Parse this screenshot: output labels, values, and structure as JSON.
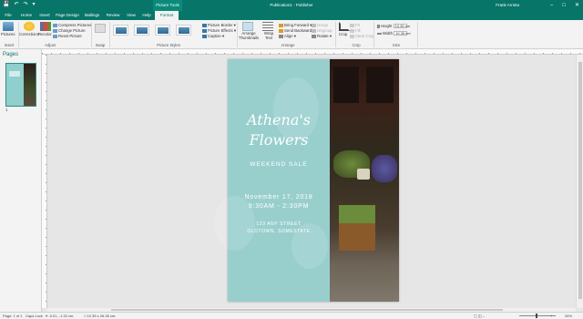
{
  "window": {
    "title": "Publication1 - Publisher",
    "context_tab_group": "Picture Tools",
    "user": "Frank Arrieta",
    "qat": [
      "save-icon",
      "undo-icon",
      "redo-icon",
      "customize-icon"
    ],
    "controls": [
      "minimize-icon",
      "maximize-icon",
      "close-icon"
    ]
  },
  "tabs": [
    {
      "label": "File"
    },
    {
      "label": "Home"
    },
    {
      "label": "Insert"
    },
    {
      "label": "Page Design"
    },
    {
      "label": "Mailings"
    },
    {
      "label": "Review"
    },
    {
      "label": "View"
    },
    {
      "label": "Help"
    },
    {
      "label": "Format",
      "active": true
    }
  ],
  "ribbon": {
    "insert": {
      "pictures": "Pictures",
      "group": "Insert"
    },
    "adjust": {
      "corrections": "Corrections",
      "recolor": "Recolor",
      "compress": "Compress Pictures",
      "change": "Change Picture",
      "reset": "Reset Picture",
      "group": "Adjust"
    },
    "swap": {
      "group": "Swap"
    },
    "picture_styles": {
      "group": "Picture Styles",
      "border": "Picture Border",
      "effects": "Picture Effects",
      "caption": "Caption"
    },
    "arrange": {
      "thumbnails": "Arrange Thumbnails",
      "wrap": "Wrap Text",
      "bring_forward": "Bring Forward",
      "send_backward": "Send Backward",
      "align": "Align",
      "group_btn": "Group",
      "ungroup": "Ungroup",
      "rotate": "Rotate",
      "group": "Arrange"
    },
    "crop": {
      "label": "Crop",
      "fit": "Fit",
      "fill": "Fill",
      "clear_crop": "Clear Crop",
      "group": "Crop"
    },
    "size": {
      "height_label": "Height",
      "height_value": "10.35 cm",
      "width_label": "Width",
      "width_value": "10.35 cm",
      "group": "Size"
    }
  },
  "pages_pane": {
    "title": "Pages",
    "page_number": "1"
  },
  "flyer": {
    "title_line1": "Athena's",
    "title_line2": "Flowers",
    "subtitle": "WEEKEND SALE",
    "date": "November 17, 2018",
    "time": "9:30AM - 2:30PM",
    "address1": "123 ANY STREET",
    "address2": "OLDTOWN, SOMESTATE"
  },
  "status": {
    "page": "Page: 1 of 1",
    "caps": "Caps Lock",
    "position": "-0.01, -1.32 cm.",
    "size": "10.35 x 26.35 cm.",
    "zoom": "34%"
  },
  "colors": {
    "accent": "#077568",
    "flyer_teal": "#98cfcd"
  }
}
